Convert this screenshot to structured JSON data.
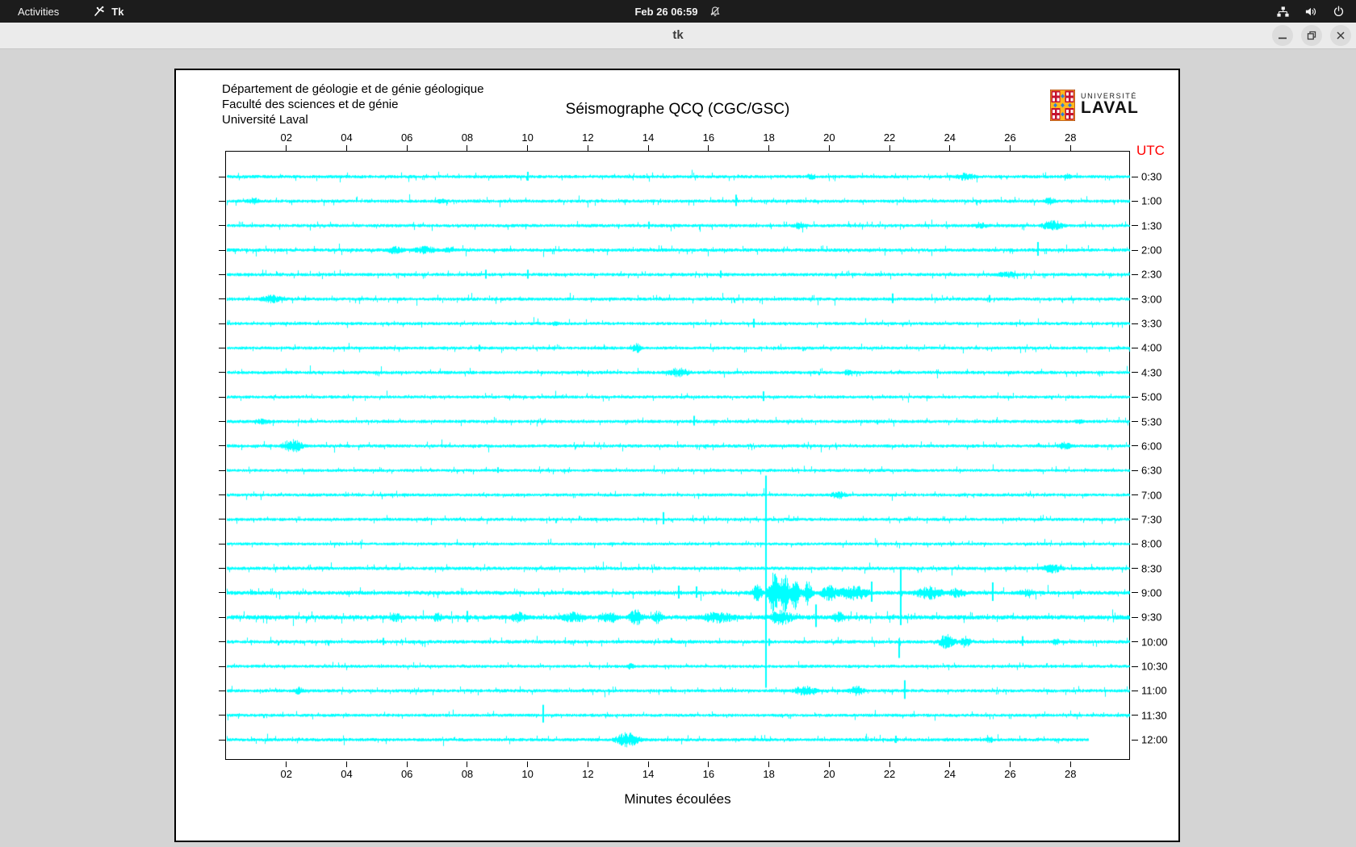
{
  "top_bar": {
    "activities_label": "Activities",
    "app_name": "Tk",
    "clock": "Feb 26 06:59",
    "icons": [
      "tk-app-icon",
      "notifications-muted-icon",
      "network-icon",
      "volume-icon",
      "power-icon"
    ]
  },
  "window": {
    "title": "tk",
    "controls": [
      "minimize-icon",
      "restore-icon",
      "close-icon"
    ]
  },
  "figure": {
    "header_lines": [
      "Département de géologie et de génie géologique",
      "Faculté des sciences et de génie",
      "Université Laval"
    ],
    "title": "Séismographe QCQ (CGC/GSC)",
    "logo": {
      "line1": "UNIVERSITÉ",
      "line2": "LAVAL"
    },
    "utc_label": "UTC",
    "xlabel": "Minutes écoulées"
  },
  "colors": {
    "trace": "#00ffff",
    "utc_label": "#ff0000",
    "topbar_bg": "#1c1c1c",
    "titlebar_bg": "#ebebeb",
    "desktop_bg": "#d4d4d4",
    "logo_red": "#c41230",
    "logo_gold": "#ffb81c",
    "logo_blue": "#2f7ed8"
  },
  "chart_data": {
    "type": "line",
    "title": "Séismographe QCQ (CGC/GSC)",
    "xlabel": "Minutes écoulées",
    "ylabel_right": "UTC",
    "x_range_minutes": [
      0,
      30
    ],
    "x_ticks": [
      "02",
      "04",
      "06",
      "08",
      "10",
      "12",
      "14",
      "16",
      "18",
      "20",
      "22",
      "24",
      "26",
      "28"
    ],
    "trace_color": "#00ffff",
    "first_row_y": 31,
    "row_spacing_px": 30.35,
    "rows": [
      {
        "label": "0:30",
        "seed": 1,
        "noise": 1,
        "events": [
          {
            "t": 10.0,
            "spike": 6,
            "dn": 5
          },
          {
            "t": 19.4,
            "w": 0.5,
            "a": 4
          },
          {
            "t": 24.5,
            "w": 1.0,
            "a": 5
          },
          {
            "t": 27.9,
            "w": 0.5,
            "a": 4
          }
        ]
      },
      {
        "label": "1:00",
        "seed": 2,
        "noise": 1,
        "events": [
          {
            "t": 0.9,
            "w": 0.7,
            "a": 4
          },
          {
            "t": 7.1,
            "w": 0.4,
            "a": 4
          },
          {
            "t": 16.9,
            "spike": 8,
            "dn": 6
          },
          {
            "t": 27.3,
            "w": 0.6,
            "a": 5
          }
        ]
      },
      {
        "label": "1:30",
        "seed": 3,
        "noise": 1,
        "events": [
          {
            "t": 14.0,
            "spike": 5,
            "dn": 4
          },
          {
            "t": 19.0,
            "w": 0.6,
            "a": 5
          },
          {
            "t": 25.0,
            "w": 0.8,
            "a": 4
          },
          {
            "t": 27.4,
            "w": 1.0,
            "a": 7
          }
        ]
      },
      {
        "label": "2:00",
        "seed": 4,
        "noise": 1.05,
        "events": [
          {
            "t": 5.6,
            "w": 0.9,
            "a": 5
          },
          {
            "t": 6.6,
            "w": 1.2,
            "a": 5
          },
          {
            "t": 7.4,
            "w": 0.6,
            "a": 4
          },
          {
            "t": 26.9,
            "spike": 10,
            "dn": 7
          }
        ]
      },
      {
        "label": "2:30",
        "seed": 5,
        "noise": 1,
        "events": [
          {
            "t": 8.6,
            "spike": 6,
            "dn": 5
          },
          {
            "t": 10.0,
            "spike": 6,
            "dn": 5
          },
          {
            "t": 16.4,
            "spike": 5,
            "dn": 4
          },
          {
            "t": 25.9,
            "w": 1.3,
            "a": 4
          }
        ]
      },
      {
        "label": "3:00",
        "seed": 6,
        "noise": 1,
        "events": [
          {
            "t": 1.5,
            "w": 1.2,
            "a": 5
          },
          {
            "t": 22.1,
            "spike": 7,
            "dn": 5
          },
          {
            "t": 25.3,
            "spike": 5,
            "dn": 4
          }
        ]
      },
      {
        "label": "3:30",
        "seed": 7,
        "noise": 0.95,
        "events": [
          {
            "t": 10.9,
            "w": 0.5,
            "a": 3
          },
          {
            "t": 17.5,
            "spike": 6,
            "dn": 5
          }
        ]
      },
      {
        "label": "4:00",
        "seed": 8,
        "noise": 0.95,
        "events": [
          {
            "t": 8.4,
            "spike": 4,
            "dn": 4
          },
          {
            "t": 13.6,
            "w": 0.5,
            "a": 6
          }
        ]
      },
      {
        "label": "4:30",
        "seed": 9,
        "noise": 1,
        "events": [
          {
            "t": 15.0,
            "w": 1.1,
            "a": 6
          },
          {
            "t": 20.6,
            "w": 0.4,
            "a": 4
          }
        ]
      },
      {
        "label": "5:00",
        "seed": 10,
        "noise": 0.95,
        "events": [
          {
            "t": 17.8,
            "spike": 7,
            "dn": 5
          }
        ]
      },
      {
        "label": "5:30",
        "seed": 11,
        "noise": 1,
        "events": [
          {
            "t": 1.2,
            "w": 0.8,
            "a": 4
          },
          {
            "t": 15.5,
            "spike": 7,
            "dn": 5
          },
          {
            "t": 28.3,
            "w": 0.4,
            "a": 4
          }
        ]
      },
      {
        "label": "6:00",
        "seed": 12,
        "noise": 1,
        "events": [
          {
            "t": 2.2,
            "w": 1.0,
            "a": 8
          },
          {
            "t": 27.8,
            "w": 0.7,
            "a": 5
          }
        ]
      },
      {
        "label": "6:30",
        "seed": 13,
        "noise": 0.9,
        "events": [
          {
            "t": 9.0,
            "spike": 4,
            "dn": 3
          }
        ]
      },
      {
        "label": "7:00",
        "seed": 14,
        "noise": 0.95,
        "events": [
          {
            "t": 20.3,
            "w": 0.8,
            "a": 5
          }
        ]
      },
      {
        "label": "7:30",
        "seed": 15,
        "noise": 0.95,
        "events": [
          {
            "t": 14.5,
            "spike": 9,
            "dn": 6
          }
        ]
      },
      {
        "label": "8:00",
        "seed": 16,
        "noise": 0.9,
        "events": []
      },
      {
        "label": "8:30",
        "seed": 17,
        "noise": 1.05,
        "events": [
          {
            "t": 17.89,
            "spike": 115,
            "dn": 148
          },
          {
            "t": 27.4,
            "w": 1.0,
            "a": 6
          }
        ]
      },
      {
        "label": "9:00",
        "seed": 18,
        "noise": 1.2,
        "events": [
          {
            "t": 15.0,
            "spike": 9,
            "dn": 7
          },
          {
            "t": 15.6,
            "spike": 8,
            "dn": 6
          },
          {
            "t": 17.6,
            "w": 0.5,
            "a": 10
          },
          {
            "t": 18.15,
            "w": 0.5,
            "a": 24
          },
          {
            "t": 18.5,
            "w": 0.45,
            "a": 26
          },
          {
            "t": 18.85,
            "w": 0.5,
            "a": 20
          },
          {
            "t": 19.3,
            "w": 0.4,
            "a": 15
          },
          {
            "t": 20.0,
            "w": 0.8,
            "a": 10
          },
          {
            "t": 20.8,
            "w": 1.6,
            "a": 9
          },
          {
            "t": 21.4,
            "spike": 14,
            "dn": 11
          },
          {
            "t": 22.35,
            "spike": 32,
            "dn": 40
          },
          {
            "t": 23.3,
            "w": 1.4,
            "a": 8
          },
          {
            "t": 24.2,
            "w": 0.8,
            "a": 6
          },
          {
            "t": 25.4,
            "spike": 13,
            "dn": 10
          },
          {
            "t": 26.5,
            "w": 0.8,
            "a": 5
          }
        ]
      },
      {
        "label": "9:30",
        "seed": 19,
        "noise": 1.35,
        "events": [
          {
            "t": 5.6,
            "w": 0.6,
            "a": 6
          },
          {
            "t": 7.0,
            "w": 0.5,
            "a": 6
          },
          {
            "t": 8.0,
            "spike": 8,
            "dn": 6
          },
          {
            "t": 9.7,
            "w": 0.8,
            "a": 7
          },
          {
            "t": 11.5,
            "w": 1.2,
            "a": 7
          },
          {
            "t": 12.7,
            "w": 0.9,
            "a": 8
          },
          {
            "t": 13.6,
            "w": 0.7,
            "a": 10
          },
          {
            "t": 14.3,
            "w": 0.5,
            "a": 8
          },
          {
            "t": 16.3,
            "w": 1.8,
            "a": 7
          },
          {
            "t": 18.4,
            "w": 1.2,
            "a": 9
          },
          {
            "t": 19.55,
            "spike": 16,
            "dn": 12
          },
          {
            "t": 20.3,
            "w": 0.7,
            "a": 7
          }
        ]
      },
      {
        "label": "10:00",
        "seed": 20,
        "noise": 1.05,
        "events": [
          {
            "t": 5.2,
            "spike": 5,
            "dn": 4
          },
          {
            "t": 18.0,
            "spike": 4,
            "dn": 5
          },
          {
            "t": 22.3,
            "spike": 4,
            "dn": 20
          },
          {
            "t": 23.9,
            "w": 0.8,
            "a": 9
          },
          {
            "t": 24.5,
            "w": 0.5,
            "a": 7
          },
          {
            "t": 26.4,
            "spike": 7,
            "dn": 5
          },
          {
            "t": 27.5,
            "w": 0.4,
            "a": 5
          }
        ]
      },
      {
        "label": "10:30",
        "seed": 21,
        "noise": 0.95,
        "events": [
          {
            "t": 13.4,
            "w": 0.4,
            "a": 4
          }
        ]
      },
      {
        "label": "11:00",
        "seed": 22,
        "noise": 1,
        "events": [
          {
            "t": 2.4,
            "w": 0.5,
            "a": 5
          },
          {
            "t": 19.2,
            "w": 1.2,
            "a": 6
          },
          {
            "t": 20.9,
            "w": 0.8,
            "a": 6
          },
          {
            "t": 22.5,
            "spike": 13,
            "dn": 10
          }
        ]
      },
      {
        "label": "11:30",
        "seed": 23,
        "noise": 0.95,
        "events": [
          {
            "t": 10.5,
            "spike": 13,
            "dn": 9
          }
        ]
      },
      {
        "label": "12:00",
        "seed": 24,
        "noise": 1,
        "end_min": 28.6,
        "events": [
          {
            "t": 13.3,
            "w": 1.1,
            "a": 9
          },
          {
            "t": 22.2,
            "spike": 5,
            "dn": 4
          },
          {
            "t": 25.3,
            "w": 0.5,
            "a": 4
          }
        ]
      }
    ]
  }
}
